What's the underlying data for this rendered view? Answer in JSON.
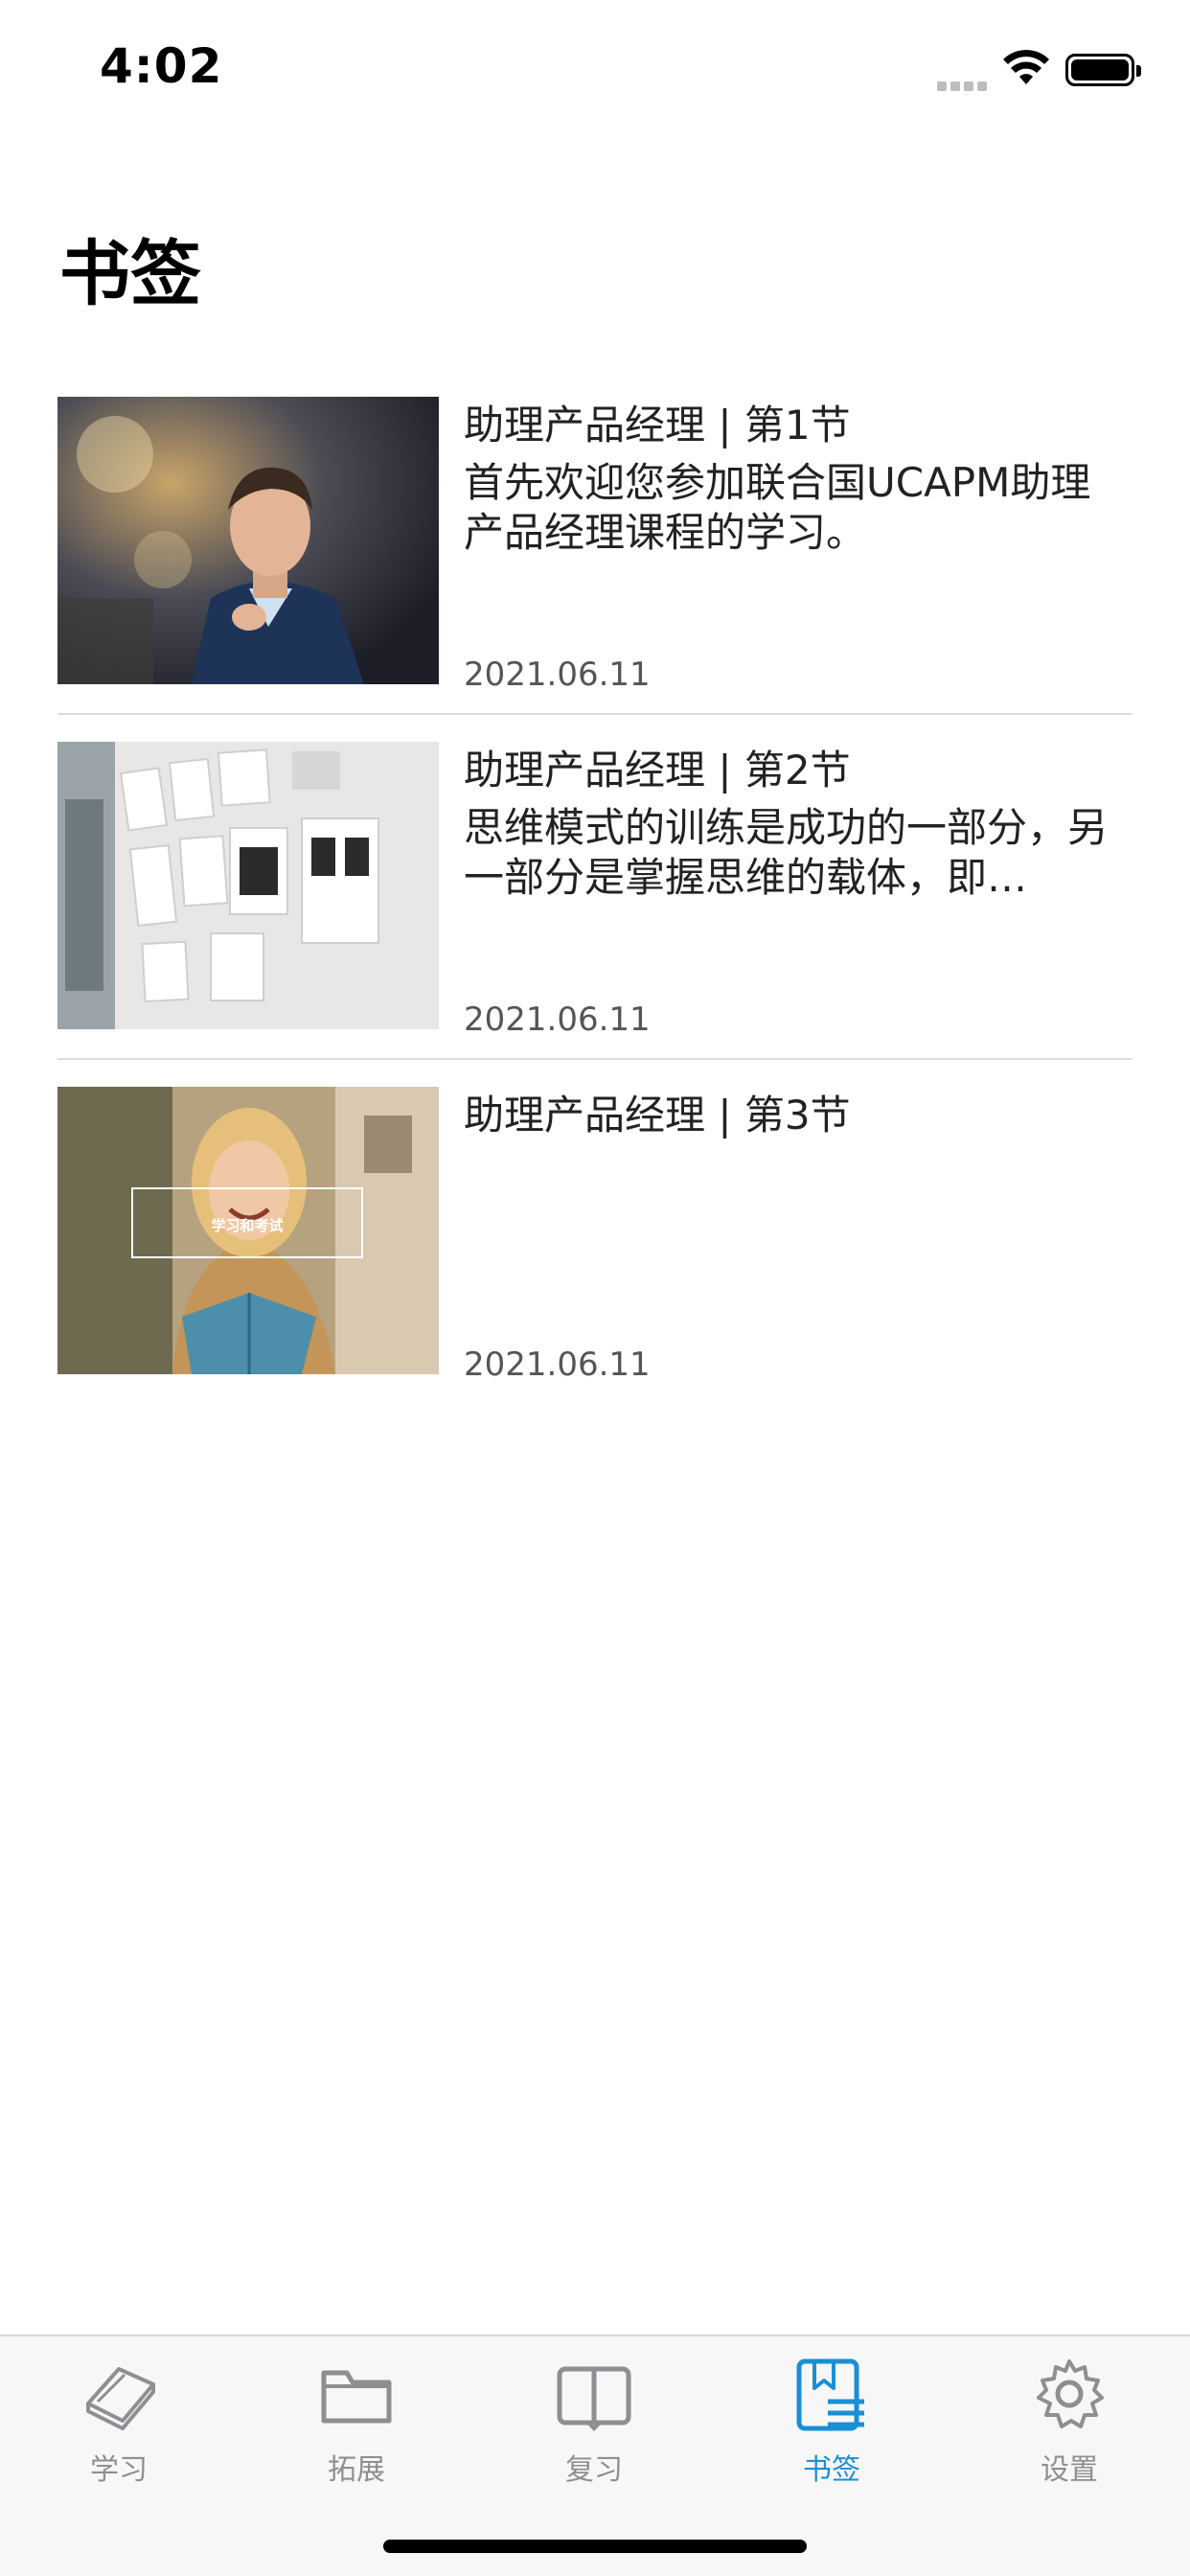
{
  "status_bar": {
    "time": "4:02"
  },
  "page": {
    "title": "书签"
  },
  "bookmarks": [
    {
      "title": "助理产品经理 |  第1节",
      "description": "首先欢迎您参加联合国UCAPM助理产品经理课程的学习。",
      "date": "2021.06.11",
      "image": "man-in-suit-photo"
    },
    {
      "title": "助理产品经理 |  第2节",
      "description": "思维模式的训练是成功的一部分，另一部分是掌握思维的载体，即…",
      "date": "2021.06.11",
      "image": "wall-wireframes-photo"
    },
    {
      "title": "助理产品经理 |  第3节",
      "description": "",
      "date": "2021.06.11",
      "image": "woman-reading-book-photo",
      "image_caption": "学习和考试"
    }
  ],
  "tabs": [
    {
      "label": "学习",
      "icon": "book-icon",
      "active": false
    },
    {
      "label": "拓展",
      "icon": "folder-icon",
      "active": false
    },
    {
      "label": "复习",
      "icon": "open-book-icon",
      "active": false
    },
    {
      "label": "书签",
      "icon": "bookmark-list-icon",
      "active": true
    },
    {
      "label": "设置",
      "icon": "gear-icon",
      "active": false
    }
  ],
  "colors": {
    "accent": "#1a8fd6",
    "inactive": "#8e8e93"
  }
}
